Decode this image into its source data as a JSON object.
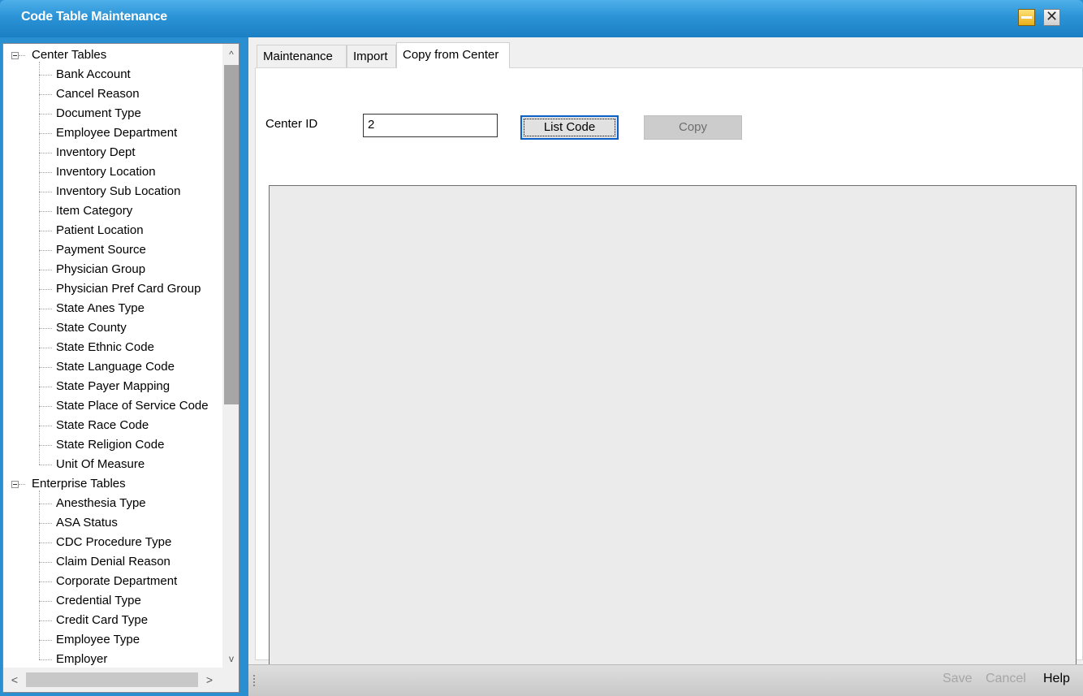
{
  "window": {
    "title": "Code Table Maintenance",
    "minimize_icon": "minimize-icon",
    "close_icon": "close-icon",
    "close_glyph": "✕"
  },
  "tree": {
    "groups": [
      {
        "label": "Center Tables",
        "expanded": true,
        "items": [
          "Bank Account",
          "Cancel Reason",
          "Document Type",
          "Employee Department",
          "Inventory Dept",
          "Inventory Location",
          "Inventory Sub Location",
          "Item Category",
          "Patient Location",
          "Payment Source",
          "Physician Group",
          "Physician Pref Card Group",
          "State Anes Type",
          "State County",
          "State Ethnic Code",
          "State Language Code",
          "State Payer Mapping",
          "State Place of Service Code",
          "State Race Code",
          "State Religion Code",
          "Unit Of Measure"
        ]
      },
      {
        "label": "Enterprise Tables",
        "expanded": true,
        "items": [
          "Anesthesia Type",
          "ASA Status",
          "CDC Procedure Type",
          "Claim Denial Reason",
          "Corporate Department",
          "Credential Type",
          "Credit Card Type",
          "Employee Type",
          "Employer"
        ]
      }
    ],
    "scroll_up_glyph": "^",
    "scroll_down_glyph": "v",
    "scroll_left_glyph": "<",
    "scroll_right_glyph": ">"
  },
  "tabs": [
    {
      "label": "Maintenance",
      "active": false
    },
    {
      "label": "Import",
      "active": false
    },
    {
      "label": "Copy from Center",
      "active": true
    }
  ],
  "form": {
    "center_id_label": "Center ID",
    "center_id_value": "2",
    "list_code_label": "List Code",
    "copy_label": "Copy"
  },
  "statusbar": {
    "save_label": "Save",
    "cancel_label": "Cancel",
    "help_label": "Help"
  },
  "colors": {
    "titlebar": "#2a93d6",
    "focus_border": "#0b61c6",
    "disabled_text": "#a6a6a6"
  }
}
